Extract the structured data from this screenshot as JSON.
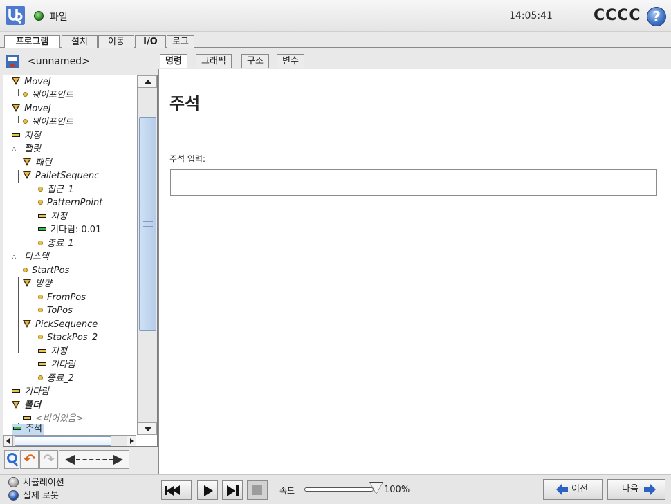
{
  "topbar": {
    "file_label": "파일",
    "clock": "14:05:41",
    "robot_name": "CCCC",
    "help_glyph": "?"
  },
  "main_tabs": [
    "프로그램",
    "설치",
    "이동",
    "I/O",
    "로그"
  ],
  "program": {
    "name": "<unnamed>"
  },
  "tree": [
    {
      "label": "MoveJ",
      "icon": "move-triangle"
    },
    {
      "label": "웨이포인트",
      "icon": "waypoint-dot"
    },
    {
      "label": "MoveJ",
      "icon": "move-triangle"
    },
    {
      "label": "웨이포인트",
      "icon": "waypoint-dot"
    },
    {
      "label": "지정",
      "icon": "set-bar"
    },
    {
      "label": "팰릿",
      "icon": "pallet-dots"
    },
    {
      "label": "패턴",
      "icon": "move-triangle"
    },
    {
      "label": "PalletSequenc",
      "icon": "move-triangle"
    },
    {
      "label": "접근_1",
      "icon": "waypoint-dot"
    },
    {
      "label": "PatternPoint",
      "icon": "waypoint-dot"
    },
    {
      "label": "지정",
      "icon": "set-bar"
    },
    {
      "label": "기다림: 0.01",
      "icon": "wait-bar-green"
    },
    {
      "label": "종료_1",
      "icon": "waypoint-dot"
    },
    {
      "label": "디스택",
      "icon": "pallet-dots"
    },
    {
      "label": "StartPos",
      "icon": "waypoint-dot"
    },
    {
      "label": "방향",
      "icon": "move-triangle"
    },
    {
      "label": "FromPos",
      "icon": "waypoint-dot"
    },
    {
      "label": "ToPos",
      "icon": "waypoint-dot"
    },
    {
      "label": "PickSequence",
      "icon": "move-triangle"
    },
    {
      "label": "StackPos_2",
      "icon": "waypoint-dot"
    },
    {
      "label": "지정",
      "icon": "set-bar"
    },
    {
      "label": "기다림",
      "icon": "wait-bar"
    },
    {
      "label": "종료_2",
      "icon": "waypoint-dot"
    },
    {
      "label": "기다림",
      "icon": "wait-bar"
    },
    {
      "label": "폴더",
      "icon": "move-triangle"
    },
    {
      "label": "<비어있음>",
      "icon": "set-bar"
    },
    {
      "label": "주석",
      "icon": "comment-bar-green"
    }
  ],
  "sub_tabs": [
    "명령",
    "그래픽",
    "구조",
    "변수"
  ],
  "command": {
    "title": "주석",
    "field_label": "주석 입력:",
    "field_value": "",
    "field_placeholder": ""
  },
  "bottom": {
    "sim_label": "시뮬레이션",
    "real_label": "실제 로봇",
    "speed_label": "속도",
    "speed_value": "100%",
    "speed_fraction": 1.0,
    "prev_label": "이전",
    "next_label": "다음"
  }
}
